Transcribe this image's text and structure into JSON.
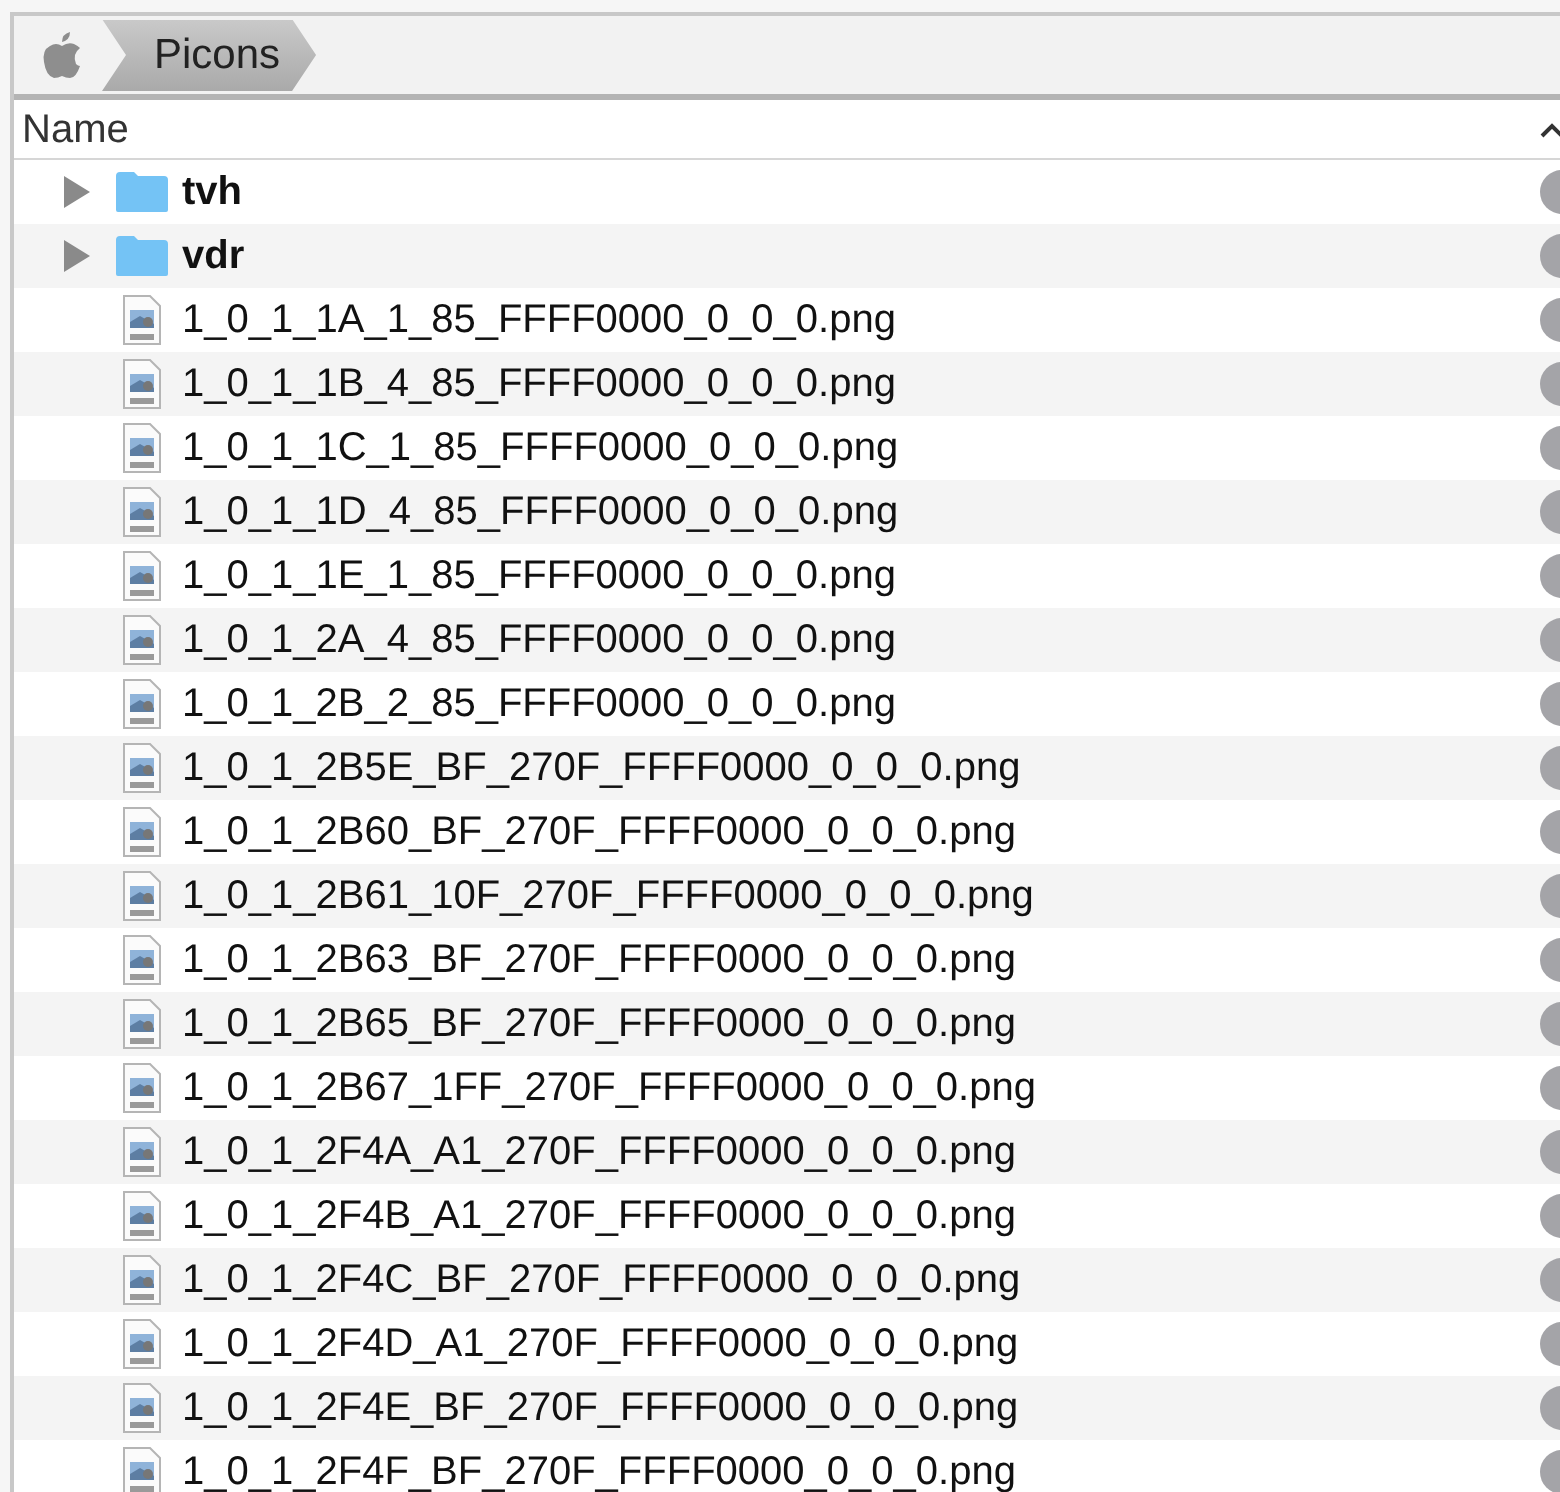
{
  "breadcrumb": {
    "items": [
      "Picons"
    ]
  },
  "table": {
    "columns": [
      {
        "label": "Name",
        "ascending": true
      }
    ],
    "rows": [
      {
        "kind": "folder",
        "name": "tvh",
        "expanded": false
      },
      {
        "kind": "folder",
        "name": "vdr",
        "expanded": false
      },
      {
        "kind": "file",
        "name": "1_0_1_1A_1_85_FFFF0000_0_0_0.png"
      },
      {
        "kind": "file",
        "name": "1_0_1_1B_4_85_FFFF0000_0_0_0.png"
      },
      {
        "kind": "file",
        "name": "1_0_1_1C_1_85_FFFF0000_0_0_0.png"
      },
      {
        "kind": "file",
        "name": "1_0_1_1D_4_85_FFFF0000_0_0_0.png"
      },
      {
        "kind": "file",
        "name": "1_0_1_1E_1_85_FFFF0000_0_0_0.png"
      },
      {
        "kind": "file",
        "name": "1_0_1_2A_4_85_FFFF0000_0_0_0.png"
      },
      {
        "kind": "file",
        "name": "1_0_1_2B_2_85_FFFF0000_0_0_0.png"
      },
      {
        "kind": "file",
        "name": "1_0_1_2B5E_BF_270F_FFFF0000_0_0_0.png"
      },
      {
        "kind": "file",
        "name": "1_0_1_2B60_BF_270F_FFFF0000_0_0_0.png"
      },
      {
        "kind": "file",
        "name": "1_0_1_2B61_10F_270F_FFFF0000_0_0_0.png"
      },
      {
        "kind": "file",
        "name": "1_0_1_2B63_BF_270F_FFFF0000_0_0_0.png"
      },
      {
        "kind": "file",
        "name": "1_0_1_2B65_BF_270F_FFFF0000_0_0_0.png"
      },
      {
        "kind": "file",
        "name": "1_0_1_2B67_1FF_270F_FFFF0000_0_0_0.png"
      },
      {
        "kind": "file",
        "name": "1_0_1_2F4A_A1_270F_FFFF0000_0_0_0.png"
      },
      {
        "kind": "file",
        "name": "1_0_1_2F4B_A1_270F_FFFF0000_0_0_0.png"
      },
      {
        "kind": "file",
        "name": "1_0_1_2F4C_BF_270F_FFFF0000_0_0_0.png"
      },
      {
        "kind": "file",
        "name": "1_0_1_2F4D_A1_270F_FFFF0000_0_0_0.png"
      },
      {
        "kind": "file",
        "name": "1_0_1_2F4E_BF_270F_FFFF0000_0_0_0.png"
      },
      {
        "kind": "file",
        "name": "1_0_1_2F4F_BF_270F_FFFF0000_0_0_0.png"
      }
    ]
  }
}
